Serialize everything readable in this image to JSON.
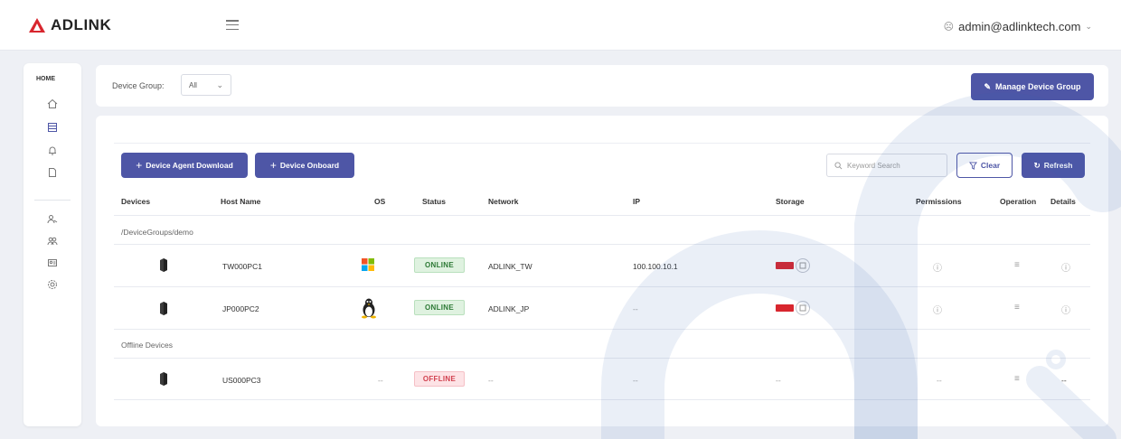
{
  "header": {
    "brand": "ADLINK",
    "user_email": "admin@adlinktech.com"
  },
  "sidebar": {
    "home_label": "HOME",
    "items": [
      "home-icon",
      "device-list-icon",
      "bell-icon",
      "file-icon",
      "user-key-icon",
      "users-icon",
      "id-card-icon",
      "settings-icon"
    ]
  },
  "device_group": {
    "label": "Device Group:",
    "selected": "All",
    "manage_button": "Manage Device Group"
  },
  "toolbar": {
    "agent_download": "Device Agent Download",
    "onboard": "Device Onboard",
    "search_placeholder": "Keyword Search",
    "clear": "Clear",
    "refresh": "Refresh"
  },
  "table": {
    "columns": [
      "Devices",
      "Host Name",
      "OS",
      "Status",
      "Network",
      "IP",
      "Storage",
      "Permissions",
      "Operation",
      "Details"
    ],
    "groups": [
      {
        "name": "/DeviceGroups/demo",
        "rows": [
          {
            "host": "TW000PC1",
            "os": "windows",
            "status": "ONLINE",
            "network": "ADLINK_TW",
            "ip": "100.100.10.1",
            "storage": "--"
          },
          {
            "host": "JP000PC2",
            "os": "linux",
            "status": "ONLINE",
            "network": "ADLINK_JP",
            "ip": "--",
            "storage": "--"
          }
        ]
      },
      {
        "name": "Offline Devices",
        "rows": [
          {
            "host": "US000PC3",
            "os": "--",
            "status": "OFFLINE",
            "network": "--",
            "ip": "--",
            "storage": "--",
            "permissions": "--",
            "details": "--"
          }
        ]
      }
    ]
  },
  "colors": {
    "primary": "#4e56a6",
    "online_bg": "#dff2e0",
    "online_text": "#2d7a36",
    "offline_bg": "#fde3e6",
    "offline_text": "#d1414f",
    "watermark": "#2d5fb3"
  }
}
